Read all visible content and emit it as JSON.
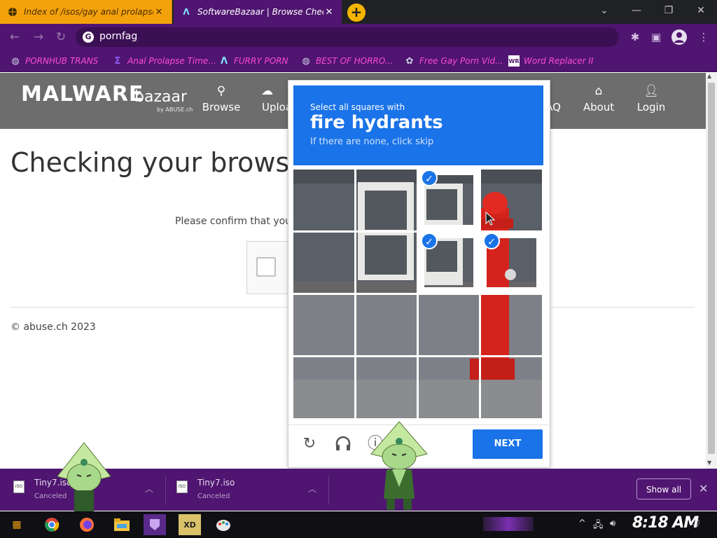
{
  "browser": {
    "tabs": [
      {
        "title": "Index of /isos/gay anal prolapse",
        "close": "✕"
      },
      {
        "title": "SoftwareBazaar | Browse Check",
        "close": "✕"
      }
    ],
    "new_tab": "+",
    "window_controls": {
      "dropdown": "⌄",
      "minimize": "—",
      "restore": "❐",
      "close": "✕"
    },
    "address": "pornfag",
    "bookmarks": [
      "PORNHUB TRANS",
      "Anal Prolapse Time...",
      "FURRY PORN",
      "BEST OF HORRO...",
      "Free Gay Porn Vid...",
      "Word Replacer II"
    ],
    "bookmark_icon_names": [
      "globe-icon",
      "sigma-icon",
      "lambda-icon",
      "globe-icon",
      "puzzle-icon",
      "wr-icon"
    ]
  },
  "site": {
    "logo_main": "MALWARE",
    "logo_sub": "bazaar",
    "logo_by": "by ABUSE.ch",
    "nav": [
      "Browse",
      "Uploa",
      "AQ",
      "About",
      "Login"
    ],
    "heading": "Checking your browser",
    "confirm_text": "Please confirm that you",
    "footer": "© abuse.ch 2023"
  },
  "captcha": {
    "select_text": "Select all squares with",
    "target": "fire hydrants",
    "skip_text": "If there are none, click skip",
    "selected_tiles": [
      2,
      6,
      7
    ],
    "next_label": "NEXT",
    "icons": [
      "refresh-icon",
      "headphones-icon",
      "info-icon"
    ]
  },
  "downloads": {
    "items": [
      {
        "name": "Tiny7.iso",
        "status": "Canceled"
      },
      {
        "name": "Tiny7.iso",
        "status": "Canceled"
      }
    ],
    "show_all": "Show all"
  },
  "taskbar": {
    "clock": "8:18 AM",
    "apps": [
      "start-icon",
      "chrome-icon",
      "firefox-icon",
      "file-explorer-icon",
      "purple-app-icon",
      "xd-icon",
      "paint-icon"
    ]
  },
  "colors": {
    "browser_purple": "#4f1570",
    "tab_active_orange": "#f4a20c",
    "captcha_blue": "#1a73e8",
    "site_header_gray": "#6d6d6d"
  }
}
